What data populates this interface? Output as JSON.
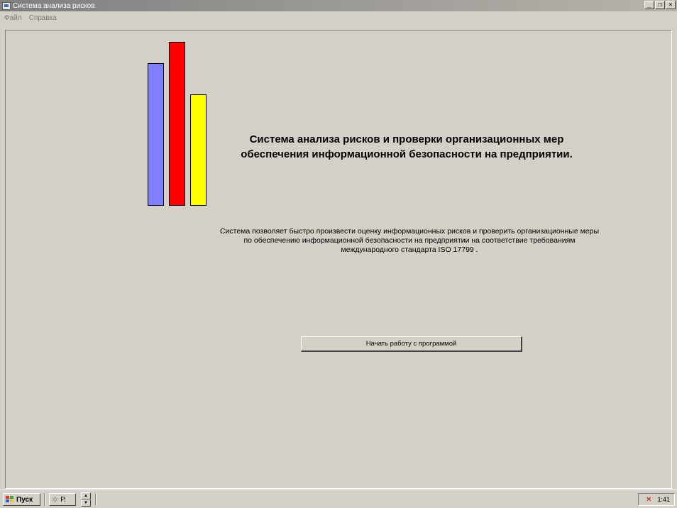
{
  "window": {
    "title": "Система анализа рисков",
    "controls": {
      "minimize": "_",
      "restore": "❐",
      "close": "×"
    }
  },
  "menu": {
    "items": [
      {
        "label": "Файл"
      },
      {
        "label": "Справка"
      }
    ]
  },
  "logo": {
    "bars": [
      {
        "color": "#8080ff",
        "level": 0.87
      },
      {
        "color": "#ff0000",
        "level": 1.0
      },
      {
        "color": "#ffff00",
        "level": 0.68
      }
    ]
  },
  "main": {
    "heading": "Система анализа рисков и проверки организационных мер обеспечения информационной безопасности на предприятии.",
    "description": "Система позволяет быстро произвести оценку информационных рисков и проверить организационные меры по обеспечению  информационной безопасности на предприятии на соответствие требованиям международного стандарта ISO 17799 .",
    "start_button": "Начать работу с программой"
  },
  "taskbar": {
    "start_label": "Пуск",
    "task_label": "Р.",
    "clock": "1:41",
    "icons": {
      "start": "windows-flag-icon",
      "task": "gear-icon",
      "tray": "network-disconnected-icon"
    }
  }
}
